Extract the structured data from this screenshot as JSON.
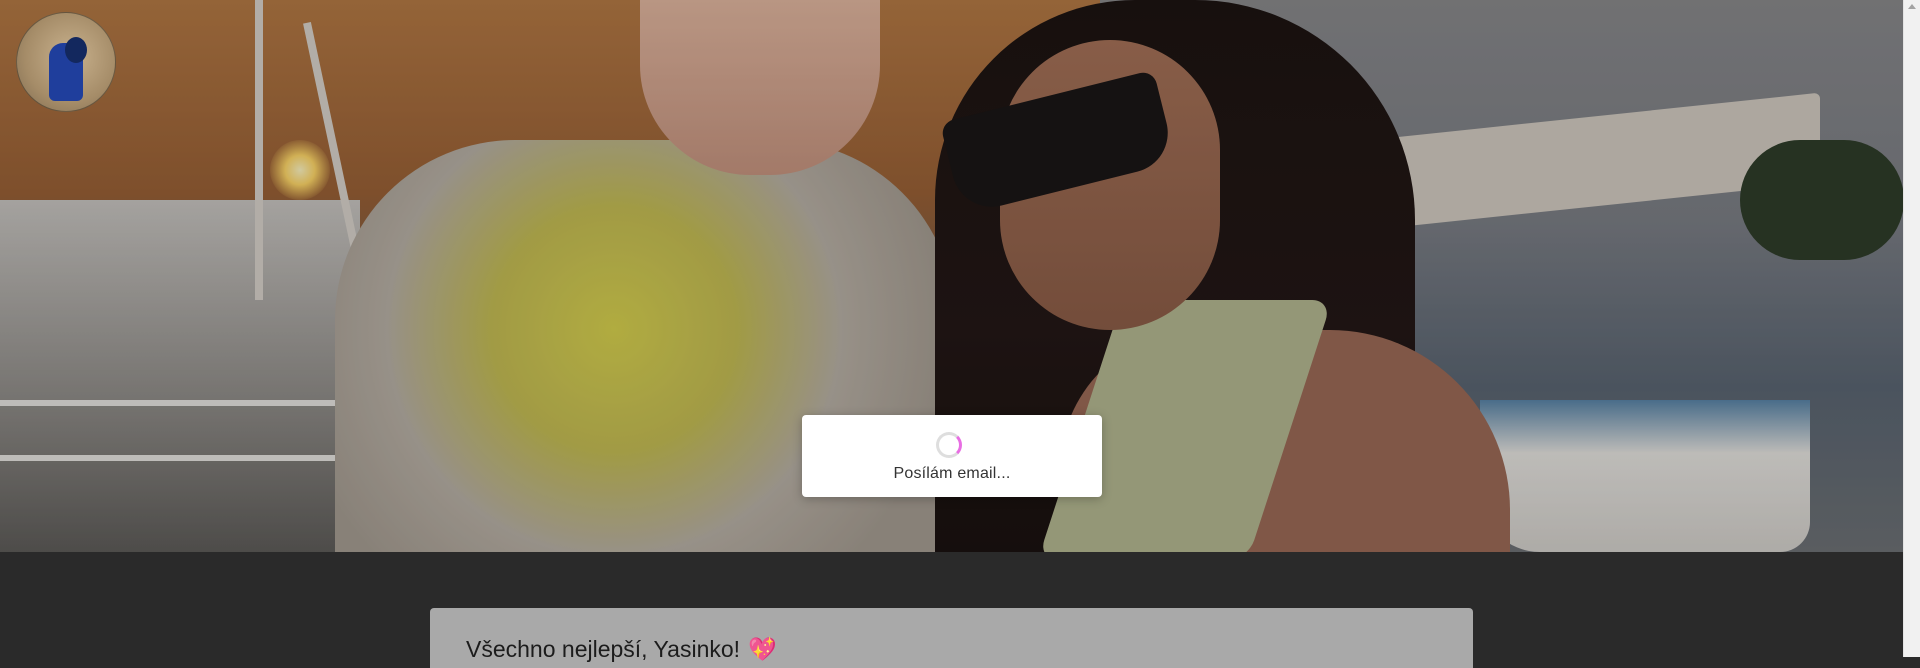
{
  "loading_dialog": {
    "message": "Posílám email..."
  },
  "card": {
    "title": "Všechno nejlepší, Yasinko!",
    "title_emoji": "💖"
  },
  "icons": {
    "spinner": "loading-spinner-icon",
    "scroll_up": "chevron-up-icon"
  },
  "colors": {
    "page_background": "#2a2a2a",
    "dialog_background": "#ffffff",
    "spinner_accent": "#e86ee3",
    "card_background": "#a9a9a9"
  }
}
